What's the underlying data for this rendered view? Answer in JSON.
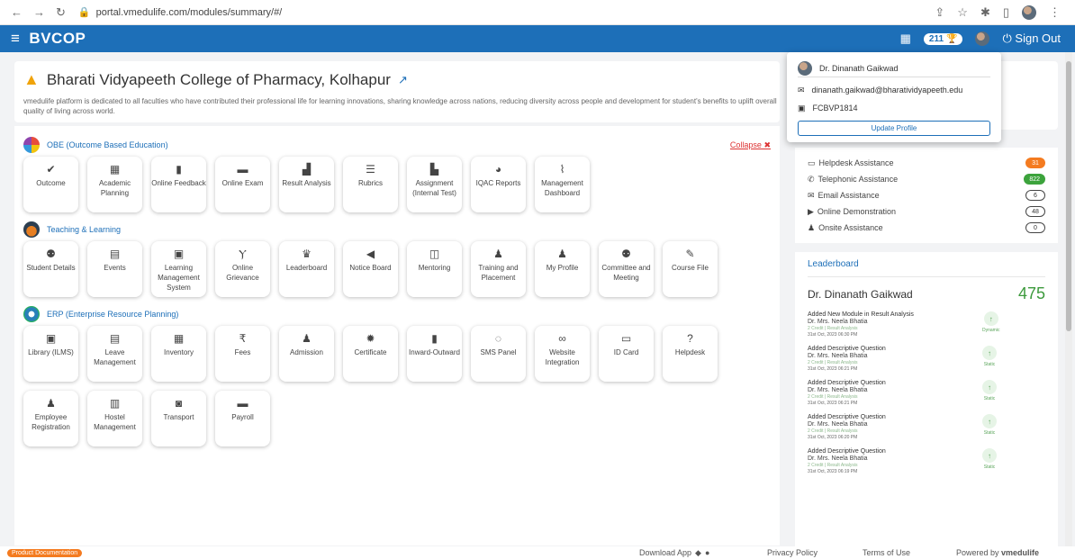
{
  "browser": {
    "url": "portal.vmedulife.com/modules/summary/#/",
    "nav_icons": [
      "back-icon",
      "forward-icon",
      "reload-icon"
    ]
  },
  "topbar": {
    "brand": "BVCOP",
    "points": "211",
    "sign_out": "Sign Out"
  },
  "header": {
    "college": "Bharati Vidyapeeth College of Pharmacy, Kolhapur",
    "description": "vmedulife platform is dedicated to all faculties who have contributed their professional life for learning innovations, sharing knowledge across nations, reducing diversity across people and development for student's benefits to uplift overall quality of living across world."
  },
  "sections": [
    {
      "title": "OBE (Outcome Based Education)",
      "collapse": "Collapse",
      "tiles": [
        {
          "icon": "✔",
          "label": "Outcome"
        },
        {
          "icon": "▦",
          "label": "Academic Planning"
        },
        {
          "icon": "▮",
          "label": "Online Feedback"
        },
        {
          "icon": "▬",
          "label": "Online Exam"
        },
        {
          "icon": "▟",
          "label": "Result Analysis"
        },
        {
          "icon": "☰",
          "label": "Rubrics"
        },
        {
          "icon": "▙",
          "label": "Assignment (Internal Test)"
        },
        {
          "icon": "◕",
          "label": "IQAC Reports"
        },
        {
          "icon": "⌇",
          "label": "Management Dashboard"
        }
      ]
    },
    {
      "title": "Teaching & Learning",
      "tiles": [
        {
          "icon": "⚉",
          "label": "Student Details"
        },
        {
          "icon": "▤",
          "label": "Events"
        },
        {
          "icon": "▣",
          "label": "Learning Management System"
        },
        {
          "icon": "Ⲩ",
          "label": "Online Grievance"
        },
        {
          "icon": "♛",
          "label": "Leaderboard"
        },
        {
          "icon": "◀",
          "label": "Notice Board"
        },
        {
          "icon": "◫",
          "label": "Mentoring"
        },
        {
          "icon": "♟",
          "label": "Training and Placement"
        },
        {
          "icon": "♟",
          "label": "My Profile"
        },
        {
          "icon": "⚉",
          "label": "Committee and Meeting"
        },
        {
          "icon": "✎",
          "label": "Course File"
        }
      ]
    },
    {
      "title": "ERP (Enterprise Resource Planning)",
      "tiles": [
        {
          "icon": "▣",
          "label": "Library (ILMS)"
        },
        {
          "icon": "▤",
          "label": "Leave Management"
        },
        {
          "icon": "▦",
          "label": "Inventory"
        },
        {
          "icon": "₹",
          "label": "Fees"
        },
        {
          "icon": "♟",
          "label": "Admission"
        },
        {
          "icon": "✹",
          "label": "Certificate"
        },
        {
          "icon": "▮",
          "label": "Inward-Outward"
        },
        {
          "icon": "◌",
          "label": "SMS Panel"
        },
        {
          "icon": "∞",
          "label": "Website Integration"
        },
        {
          "icon": "▭",
          "label": "ID Card"
        },
        {
          "icon": "?",
          "label": "Helpdesk"
        },
        {
          "icon": "♟",
          "label": "Employee Registration"
        },
        {
          "icon": "▥",
          "label": "Hostel Management"
        },
        {
          "icon": "◙",
          "label": "Transport"
        },
        {
          "icon": "▬",
          "label": "Payroll"
        }
      ]
    }
  ],
  "profile_popup": {
    "name": "Dr. Dinanath Gaikwad",
    "email": "dinanath.gaikwad@bharatividyapeeth.edu",
    "id": "FCBVP1814",
    "button": "Update Profile"
  },
  "assistance": [
    {
      "icon": "▭",
      "label": "Helpdesk Assistance",
      "count": "31",
      "style": "orange"
    },
    {
      "icon": "✆",
      "label": "Telephonic Assistance",
      "count": "822",
      "style": "green"
    },
    {
      "icon": "✉",
      "label": "Email Assistance",
      "count": "6",
      "style": "outline"
    },
    {
      "icon": "▶",
      "label": "Online Demonstration",
      "count": "48",
      "style": "outline"
    },
    {
      "icon": "♟",
      "label": "Onsite Assistance",
      "count": "0",
      "style": "outline"
    }
  ],
  "leaderboard": {
    "title": "Leaderboard",
    "name": "Dr. Dinanath Gaikwad",
    "score": "475",
    "entries": [
      {
        "title": "Added New Module in Result Analysis",
        "by": "Dr. Mrs. Neela Bhatia",
        "credit": "2 Credit | Result Analysis",
        "date": "31st Oct, 2023 06:30 PM",
        "type": "Dynamic"
      },
      {
        "title": "Added Descriptive Question",
        "by": "Dr. Mrs. Neela Bhatia",
        "credit": "2 Credit | Result Analysis",
        "date": "31st Oct, 2023 06:21 PM",
        "type": "Static"
      },
      {
        "title": "Added Descriptive Question",
        "by": "Dr. Mrs. Neela Bhatia",
        "credit": "2 Credit | Result Analysis",
        "date": "31st Oct, 2023 06:21 PM",
        "type": "Static"
      },
      {
        "title": "Added Descriptive Question",
        "by": "Dr. Mrs. Neela Bhatia",
        "credit": "2 Credit | Result Analysis",
        "date": "31st Oct, 2023 06:20 PM",
        "type": "Static"
      },
      {
        "title": "Added Descriptive Question",
        "by": "Dr. Mrs. Neela Bhatia",
        "credit": "2 Credit | Result Analysis",
        "date": "31st Oct, 2023 06:19 PM",
        "type": "Static"
      }
    ]
  },
  "footer": {
    "product_docs": "Product Documentation",
    "download_app": "Download App",
    "privacy": "Privacy Policy",
    "terms": "Terms of Use",
    "powered": "Powered by",
    "powered_brand": "vmedulife"
  }
}
